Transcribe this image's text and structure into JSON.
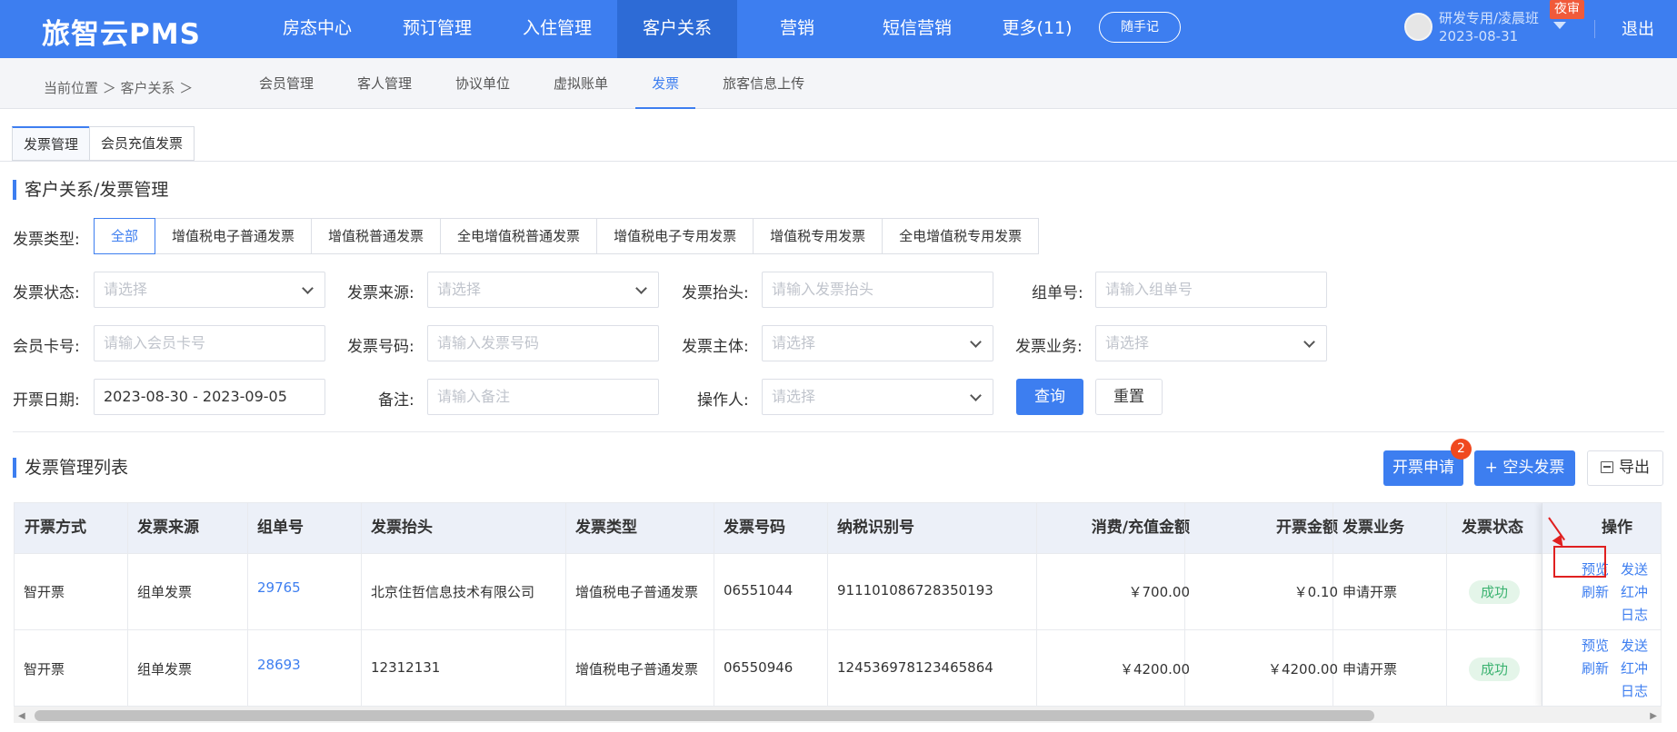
{
  "header": {
    "logo": "旅智云PMS",
    "nav": [
      "房态中心",
      "预订管理",
      "入住管理",
      "客户关系",
      "营销",
      "短信营销",
      "更多(11)"
    ],
    "memo_button": "随手记",
    "user": "研发专用/凌晨班",
    "date": "2023-08-31",
    "night_badge": "夜审",
    "logout": "退出"
  },
  "breadcrumb": "当前位置 ＞ 客户关系 ＞",
  "subnav": [
    "会员管理",
    "客人管理",
    "协议单位",
    "虚拟账单",
    "发票",
    "旅客信息上传"
  ],
  "page_tabs": [
    "发票管理",
    "会员充值发票"
  ],
  "section_title": "客户关系/发票管理",
  "filters": {
    "type_label": "发票类型:",
    "types": [
      "全部",
      "增值税电子普通发票",
      "增值税普通发票",
      "全电增值税普通发票",
      "增值税电子专用发票",
      "增值税专用发票",
      "全电增值税专用发票"
    ],
    "status_label": "发票状态:",
    "status_ph": "请选择",
    "source_label": "发票来源:",
    "source_ph": "请选择",
    "title_label": "发票抬头:",
    "title_ph": "请输入发票抬头",
    "group_label": "组单号:",
    "group_ph": "请输入组单号",
    "member_label": "会员卡号:",
    "member_ph": "请输入会员卡号",
    "number_label": "发票号码:",
    "number_ph": "请输入发票号码",
    "subject_label": "发票主体:",
    "subject_ph": "请选择",
    "business_label": "发票业务:",
    "business_ph": "请选择",
    "date_label": "开票日期:",
    "date_value": "2023-08-30 - 2023-09-05",
    "remark_label": "备注:",
    "remark_ph": "请输入备注",
    "operator_label": "操作人:",
    "operator_ph": "请选择",
    "query_button": "查询",
    "reset_button": "重置"
  },
  "list": {
    "title": "发票管理列表",
    "apply_button": "开票申请",
    "apply_badge": "2",
    "blank_button": "+ 空头发票",
    "export_button": "导出",
    "headers": [
      "开票方式",
      "发票来源",
      "组单号",
      "发票抬头",
      "发票类型",
      "发票号码",
      "纳税识别号",
      "消费/充值金额",
      "开票金额",
      "发票业务",
      "发票状态",
      "操作"
    ],
    "rows": [
      {
        "method": "智开票",
        "source": "组单发票",
        "group": "29765",
        "title": "北京住哲信息技术有限公司",
        "type": "增值税电子普通发票",
        "number": "06551044",
        "tax_id": "911101086728350193",
        "consume": "￥700.00",
        "amount": "￥0.10",
        "business": "申请开票",
        "status": "成功",
        "ops": [
          "预览",
          "发送",
          "刷新",
          "红冲",
          "日志"
        ]
      },
      {
        "method": "智开票",
        "source": "组单发票",
        "group": "28693",
        "title": "12312131",
        "type": "增值税电子普通发票",
        "number": "06550946",
        "tax_id": "124536978123465864",
        "consume": "￥4200.00",
        "amount": "￥4200.00",
        "business": "申请开票",
        "status": "成功",
        "ops": [
          "预览",
          "发送",
          "刷新",
          "红冲",
          "日志"
        ]
      }
    ]
  },
  "colors": {
    "accent": "#3d7ef0",
    "success": "#3cb371",
    "badge": "#f0491f",
    "highlight": "#e02020"
  }
}
